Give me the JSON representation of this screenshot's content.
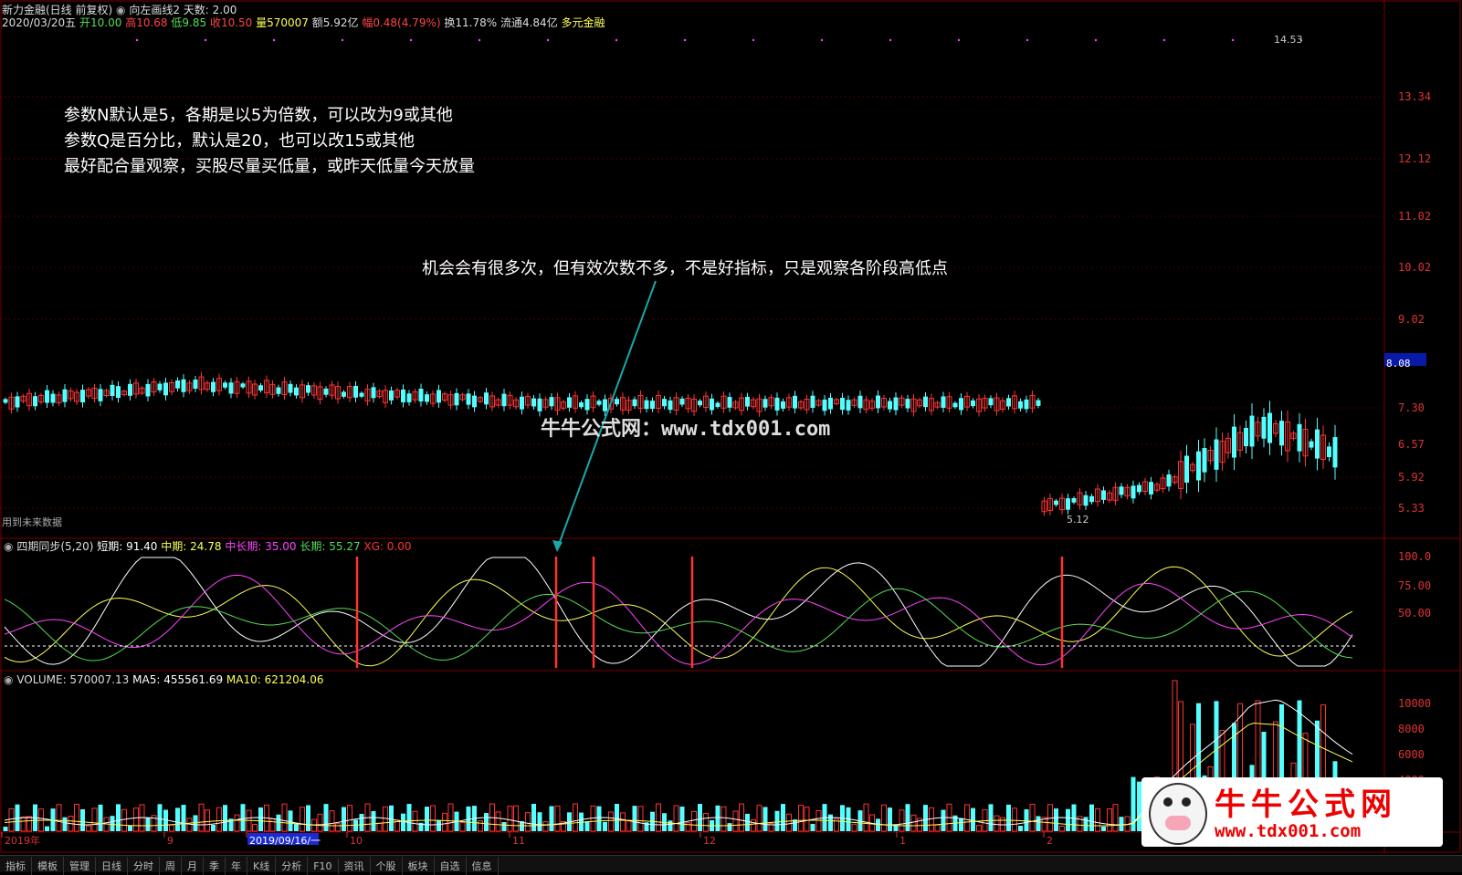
{
  "header": {
    "stock_name": "新力金融(日线 前复权)",
    "indicator": "向左画线2",
    "days_label": "天数: 2.00",
    "date": "2020/03/20五",
    "open": "开10.00",
    "high": "高10.68",
    "low": "低9.85",
    "close": "收10.50",
    "volume": "量570007",
    "amount": "额5.92亿",
    "change": "幅0.48(4.79%)",
    "turnover": "换11.78%",
    "float_cap": "流通4.84亿",
    "concept": "多元金融"
  },
  "notes": {
    "line1": "参数N默认是5，各期是以5为倍数，可以改为9或其他",
    "line2": "参数Q是百分比，默认是20，也可以改15或其他",
    "line3": "最好配合量观察，买股尽量买低量，或昨天低量今天放量",
    "callout": "机会会有很多次，但有效次数不多，不是好指标，只是观察各阶段高低点"
  },
  "watermark": "牛牛公式网：www.tdx001.com",
  "future_data": "用到未来数据",
  "price_axis": [
    "13.34",
    "12.12",
    "11.02",
    "10.02",
    "9.02",
    "7.30",
    "6.57",
    "5.92",
    "5.33"
  ],
  "current_price": "8.08",
  "high_mark": "14.53",
  "low_mark": "5.12",
  "indicator_panel": {
    "title": "四期同步(5,20)",
    "short": "短期: 91.40",
    "mid": "中期: 24.78",
    "midlong": "中长期: 35.00",
    "long": "长期: 55.27",
    "xg": "XG: 0.00",
    "axis": [
      "100.0",
      "75.00",
      "50.00"
    ]
  },
  "volume_panel": {
    "title": "VOLUME: 570007.13",
    "ma5": "MA5: 455561.69",
    "ma10": "MA10: 621204.06",
    "axis": [
      "10000",
      "8000",
      "6000",
      "4000"
    ]
  },
  "time_axis": [
    "2019年",
    "9",
    "2019/09/16/一",
    "10",
    "11",
    "12",
    "1",
    "2"
  ],
  "logo": {
    "cn": "牛牛公式网",
    "url": "www.tdx001.com"
  },
  "bottom_tabs": [
    "指标",
    "模板",
    "管理",
    "日线",
    "分时",
    "周",
    "月",
    "季",
    "年",
    "K线",
    "分析",
    "F10",
    "资讯",
    "个股",
    "板块",
    "自选",
    "信息"
  ],
  "colors": {
    "up": "#ff3333",
    "down": "#54ffff",
    "bg": "#000000",
    "grid": "#7a0000",
    "yellow": "#ffff55",
    "magenta": "#ff44ff",
    "green": "#55dd55",
    "white": "#ffffff"
  }
}
